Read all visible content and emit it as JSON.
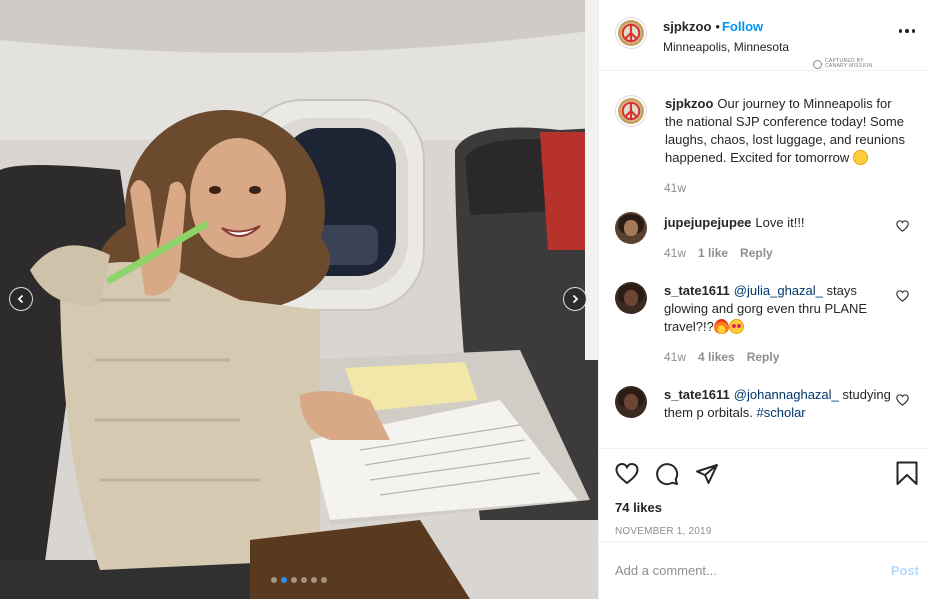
{
  "header": {
    "username": "sjpkzoo",
    "separator": "•",
    "follow_label": "Follow",
    "location": "Minneapolis, Minnesota",
    "captured_text": "CAPTURED BY CANARY MISSION"
  },
  "caption": {
    "username": "sjpkzoo",
    "text": "Our journey to Minneapolis for the national SJP conference today! Some laughs, chaos, lost luggage, and reunions happened. Excited for tomorrow",
    "emoji": "sweat-smile-emoji",
    "time": "41w"
  },
  "comments": [
    {
      "username": "jupejupejupee",
      "text": "Love it!!!",
      "mention": "",
      "time": "41w",
      "likes": "1 like",
      "reply_label": "Reply"
    },
    {
      "username": "s_tate1611",
      "mention": "@julia_ghazal_",
      "text": "stays glowing and gorg even thru PLANE travel?!?",
      "time": "41w",
      "likes": "4 likes",
      "reply_label": "Reply"
    },
    {
      "username": "s_tate1611",
      "mention": "@johannaghazal_",
      "text": "studying them p orbitals.",
      "hashtag": "#scholar"
    }
  ],
  "actions": {
    "likes": "74 likes",
    "date": "NOVEMBER 1, 2019"
  },
  "add_comment": {
    "placeholder": "Add a comment...",
    "post_label": "Post"
  },
  "carousel": {
    "count": 6,
    "active_index": 1
  },
  "colors": {
    "follow": "#0095f6",
    "post_disabled": "#b3dbff",
    "muted": "#8e8e8e",
    "text": "#262626",
    "carousel_active": "#2f8ff0"
  }
}
